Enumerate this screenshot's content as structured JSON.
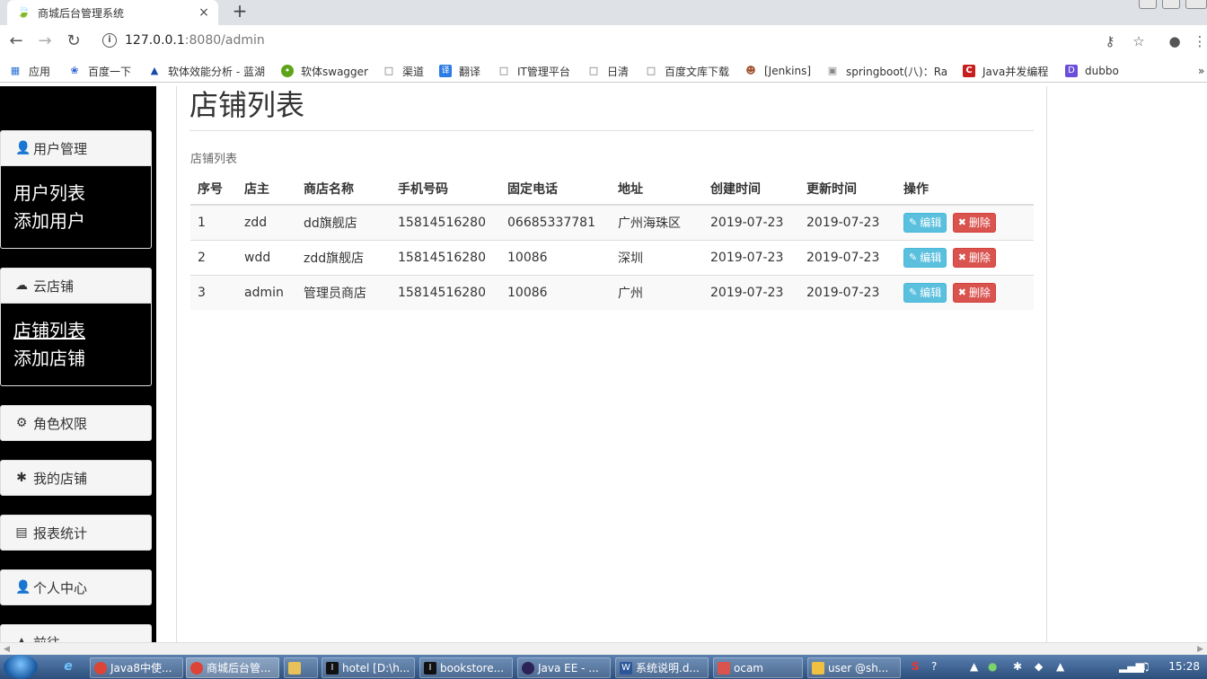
{
  "browser": {
    "tab_title": "商城后台管理系统",
    "close_glyph": "×",
    "new_tab_glyph": "+",
    "url_host": "127.0.0.1",
    "url_path": ":8080/admin"
  },
  "bookmarks": [
    {
      "label": "应用",
      "icon": "apps-grid-icon"
    },
    {
      "label": "百度一下",
      "icon": "baidu-icon"
    },
    {
      "label": "软体效能分析 - 蓝湖",
      "icon": "lanhu-icon"
    },
    {
      "label": "软体swagger",
      "icon": "swagger-icon"
    },
    {
      "label": "渠道",
      "icon": "page-icon"
    },
    {
      "label": "翻译",
      "icon": "translate-icon"
    },
    {
      "label": "IT管理平台",
      "icon": "page-icon"
    },
    {
      "label": "日清",
      "icon": "page-icon"
    },
    {
      "label": "百度文库下载",
      "icon": "page-icon"
    },
    {
      "label": "[Jenkins]",
      "icon": "jenkins-icon"
    },
    {
      "label": "springboot(八)：Ra",
      "icon": "page-icon"
    },
    {
      "label": "Java并发编程",
      "icon": "csdn-icon"
    },
    {
      "label": "dubbo",
      "icon": "dubbo-icon"
    }
  ],
  "sidebar": {
    "groups": [
      {
        "label": "用户管理",
        "icon": "user-icon",
        "items": [
          "用户列表",
          "添加用户"
        ]
      },
      {
        "label": "云店铺",
        "icon": "cloud-icon",
        "items": [
          "店铺列表",
          "添加店铺"
        ]
      },
      {
        "label": "角色权限",
        "icon": "cog-icon"
      },
      {
        "label": "我的店铺",
        "icon": "asterisk-icon"
      },
      {
        "label": "报表统计",
        "icon": "list-alt-icon"
      },
      {
        "label": "个人中心",
        "icon": "user-icon"
      },
      {
        "label": "前往",
        "icon": "home-icon"
      }
    ]
  },
  "main": {
    "page_title": "店铺列表",
    "section_label": "店铺列表",
    "columns": [
      "序号",
      "店主",
      "商店名称",
      "手机号码",
      "固定电话",
      "地址",
      "创建时间",
      "更新时间",
      "操作"
    ],
    "rows": [
      {
        "id": "1",
        "owner": "zdd",
        "name": "dd旗舰店",
        "mobile": "15814516280",
        "phone": "06685337781",
        "address": "广州海珠区",
        "created": "2019-07-23",
        "updated": "2019-07-23"
      },
      {
        "id": "2",
        "owner": "wdd",
        "name": "zdd旗舰店",
        "mobile": "15814516280",
        "phone": "10086",
        "address": "深圳",
        "created": "2019-07-23",
        "updated": "2019-07-23"
      },
      {
        "id": "3",
        "owner": "admin",
        "name": "管理员商店",
        "mobile": "15814516280",
        "phone": "10086",
        "address": "广州",
        "created": "2019-07-23",
        "updated": "2019-07-23"
      }
    ],
    "edit_label": "编辑",
    "delete_label": "删除"
  },
  "taskbar": {
    "tasks": [
      "Java8中使...",
      "商城后台管...",
      "",
      "hotel [D:\\h...",
      "bookstore...",
      "Java EE - ...",
      "系统说明.d...",
      "ocam",
      "user @sh..."
    ],
    "clock": "15:28"
  },
  "colors": {
    "sidebar_bg": "#000000",
    "edit_btn": "#5bc0de",
    "delete_btn": "#d9534f"
  }
}
